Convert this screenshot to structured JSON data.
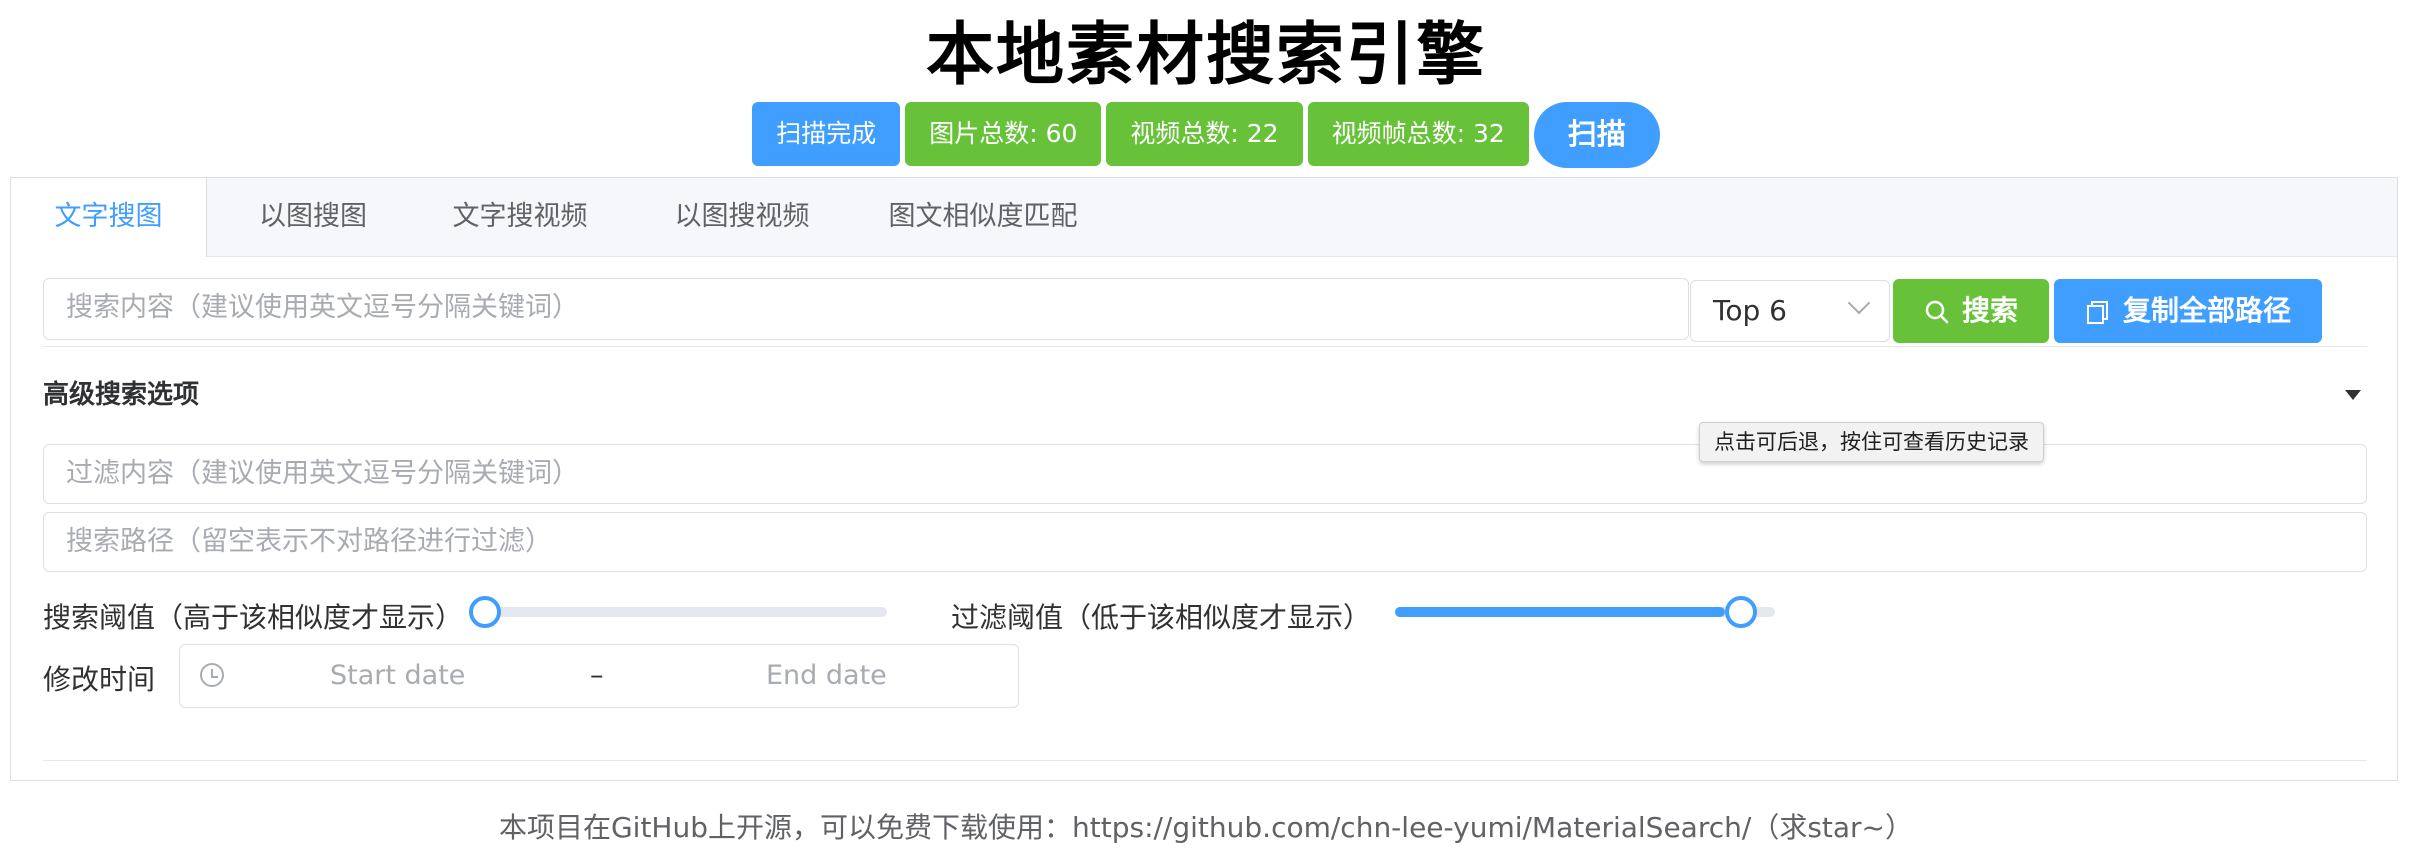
{
  "title": "本地素材搜索引擎",
  "status": {
    "scan_state": "扫描完成",
    "image_count": "图片总数: 60",
    "video_count": "视频总数: 22",
    "frame_count": "视频帧总数: 32",
    "scan_button": "扫描"
  },
  "tabs": [
    {
      "label": "文字搜图",
      "active": true
    },
    {
      "label": "以图搜图",
      "active": false
    },
    {
      "label": "文字搜视频",
      "active": false
    },
    {
      "label": "以图搜视频",
      "active": false
    },
    {
      "label": "图文相似度匹配",
      "active": false
    }
  ],
  "search": {
    "placeholder": "搜索内容（建议使用英文逗号分隔关键词）",
    "top_select": "Top 6",
    "search_button": "搜索",
    "copy_button": "复制全部路径"
  },
  "advanced": {
    "title": "高级搜索选项",
    "filter_placeholder": "过滤内容（建议使用英文逗号分隔关键词）",
    "path_placeholder": "搜索路径（留空表示不对路径进行过滤）",
    "search_threshold_label": "搜索阈值（高于该相似度才显示）",
    "search_threshold_value": 0,
    "filter_threshold_label": "过滤阈值（低于该相似度才显示）",
    "filter_threshold_value": 0.88,
    "modified_time_label": "修改时间",
    "start_date_placeholder": "Start date",
    "date_separator": "–",
    "end_date_placeholder": "End date"
  },
  "tooltip": "点击可后退，按住可查看历史记录",
  "footer": "本项目在GitHub上开源，可以免费下载使用：https://github.com/chn-lee-yumi/MaterialSearch/（求star~）",
  "colors": {
    "primary": "#409eff",
    "success": "#67c23a",
    "border": "#dcdfe6"
  }
}
